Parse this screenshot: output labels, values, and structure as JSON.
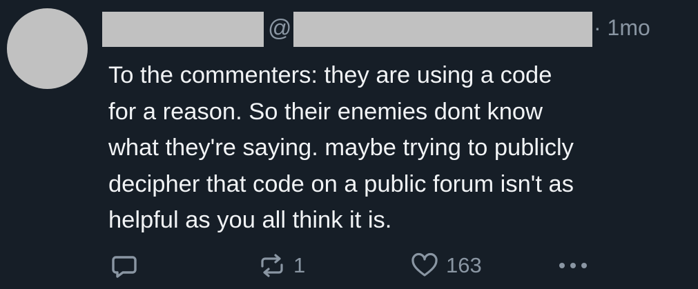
{
  "post": {
    "at_symbol": "@",
    "time": "· 1mo",
    "lines": [
      "To the commenters: they are using a code",
      "for a reason. So their enemies dont know",
      "what they're saying. maybe trying to publicly",
      "decipher that code on a public forum isn't as",
      "helpful as you all think it is."
    ],
    "actions": {
      "reply_icon": "speech-bubble-icon",
      "repost_icon": "repost-arrows-icon",
      "repost_count": "1",
      "like_icon": "heart-outline-icon",
      "like_count": "163",
      "more_icon": "ellipsis-icon"
    }
  },
  "colors": {
    "background": "#161e27",
    "text": "#f1f3f5",
    "muted": "#8a96a3",
    "redaction": "#c1c1c1"
  }
}
